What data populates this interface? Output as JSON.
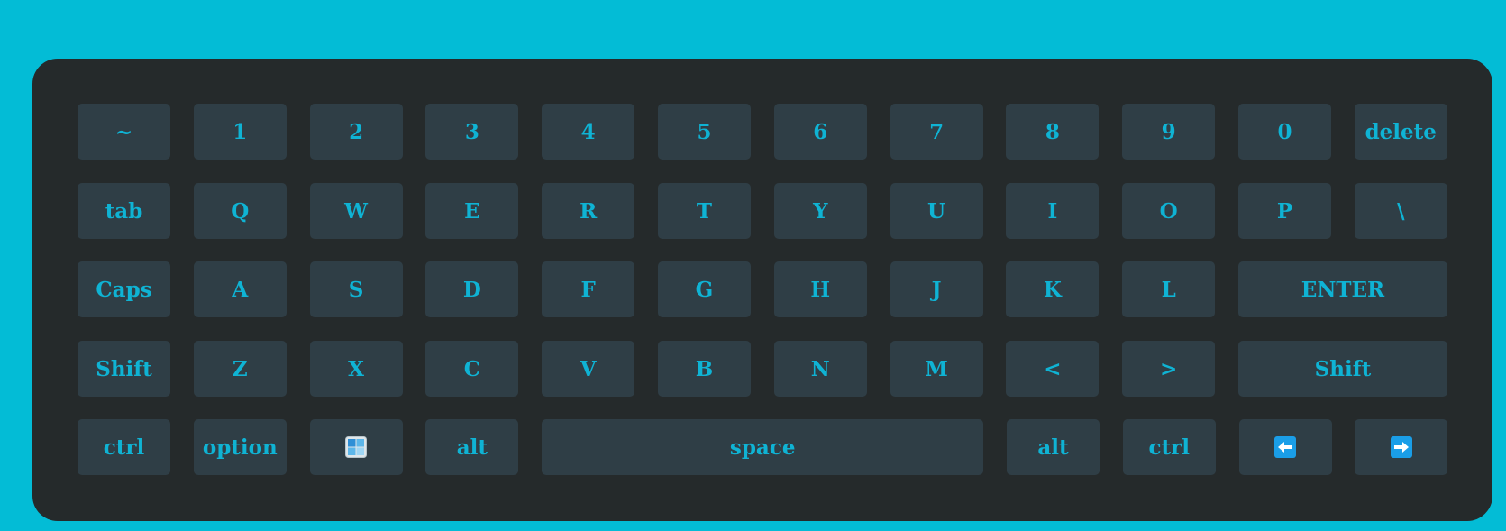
{
  "keyboard": {
    "accent_color": "#0fb3d4",
    "key_color": "#2f3e46",
    "board_color": "#252a2b",
    "background_color": "#03bcd6",
    "rows": [
      [
        "~",
        "1",
        "2",
        "3",
        "4",
        "5",
        "6",
        "7",
        "8",
        "9",
        "0",
        "delete"
      ],
      [
        "tab",
        "Q",
        "W",
        "E",
        "R",
        "T",
        "Y",
        "U",
        "I",
        "O",
        "P",
        "\\"
      ],
      [
        "Caps",
        "A",
        "S",
        "D",
        "F",
        "G",
        "H",
        "J",
        "K",
        "L",
        "ENTER"
      ],
      [
        "Shift",
        "Z",
        "X",
        "C",
        "V",
        "B",
        "N",
        "M",
        "<",
        ">",
        "Shift"
      ],
      [
        "ctrl",
        "option",
        "windows-icon",
        "alt",
        "space",
        "alt",
        "ctrl",
        "left-arrow-icon",
        "right-arrow-icon"
      ]
    ]
  }
}
